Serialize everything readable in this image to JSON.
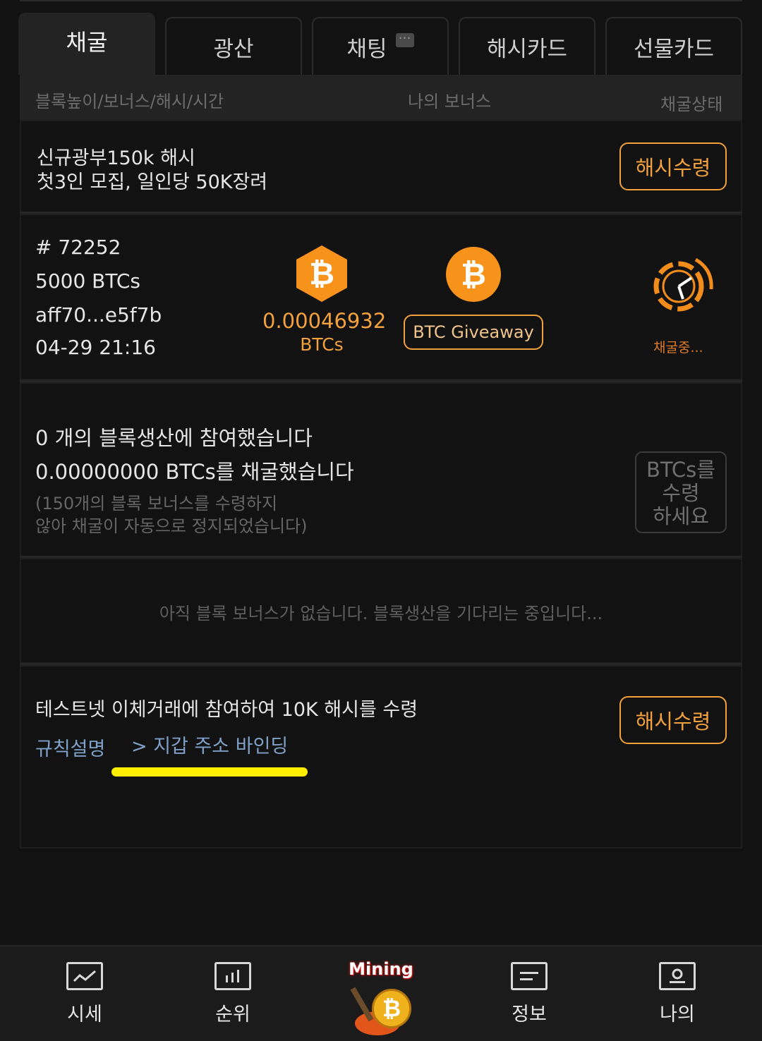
{
  "tabs": [
    {
      "label": "채굴",
      "active": true
    },
    {
      "label": "광산",
      "active": false
    },
    {
      "label": "채팅",
      "active": false
    },
    {
      "label": "해시카드",
      "active": false
    },
    {
      "label": "선물카드",
      "active": false
    }
  ],
  "header": {
    "col1": "블록높이/보너스/해시/시간",
    "col2": "나의 보너스",
    "col3": "채굴상태"
  },
  "promo": {
    "line1": "신규광부150k 해시",
    "line2": "첫3인 모집, 일인당 50K장려",
    "button": "해시수령"
  },
  "block": {
    "height": "# 72252",
    "bonus": "5000 BTCs",
    "hash": "aff70...e5f7b",
    "time": "04-29 21:16",
    "my_bonus_value": "0.00046932",
    "my_bonus_unit": "BTCs",
    "giveaway_button": "BTC Giveaway",
    "status": "채굴중..."
  },
  "summary": {
    "line1": "0 개의 블록생산에 참여했습니다",
    "line2": "0.00000000 BTCs를 채굴했습니다",
    "note1": "(150개의 블록 보너스를 수령하지",
    "note2": "않아 채굴이 자동으로 정지되었습니다)",
    "button_l1": "BTCs를",
    "button_l2": "수령",
    "button_l3": "하세요"
  },
  "empty_message": "아직 블록 보너스가 없습니다. 블록생산을 기다리는 중입니다...",
  "testnet": {
    "text": "테스트넷 이체거래에 참여하여 10K 해시를 수령",
    "rules_link": "규칙설명",
    "wallet_link": "> 지갑 주소 바인딩",
    "button": "해시수령"
  },
  "colors": {
    "accent": "#f2a13c",
    "link": "#7fa0c8",
    "highlight": "#ffee00",
    "bitcoin": "#f7931a"
  },
  "nav": [
    {
      "label": "시세",
      "icon": "line-chart-icon"
    },
    {
      "label": "순위",
      "icon": "bar-chart-icon"
    },
    {
      "label": "Mining",
      "icon": "mining-bitcoin-icon"
    },
    {
      "label": "정보",
      "icon": "document-icon"
    },
    {
      "label": "나의",
      "icon": "profile-icon"
    }
  ]
}
